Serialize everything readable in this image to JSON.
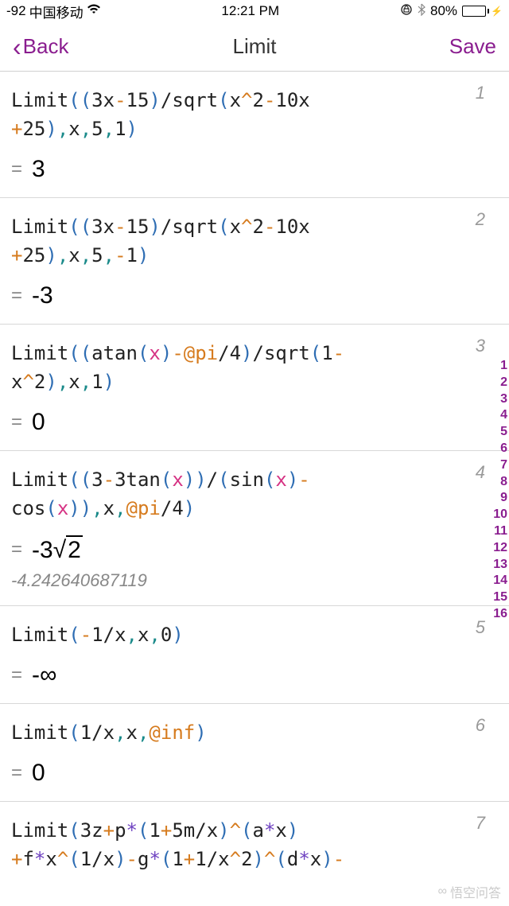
{
  "status": {
    "signal": "-92",
    "carrier": "中国移动",
    "time": "12:21 PM",
    "battery_pct": "80%"
  },
  "nav": {
    "back": "Back",
    "title": "Limit",
    "save": "Save"
  },
  "entries": [
    {
      "num": "1",
      "tokens": [
        {
          "t": "Limit",
          "c": "t-black"
        },
        {
          "t": "(",
          "c": "t-paren"
        },
        {
          "t": "(",
          "c": "t-paren"
        },
        {
          "t": "3x",
          "c": "t-black"
        },
        {
          "t": "-",
          "c": "t-orange"
        },
        {
          "t": "15",
          "c": "t-black"
        },
        {
          "t": ")",
          "c": "t-paren"
        },
        {
          "t": "/",
          "c": "t-black"
        },
        {
          "t": "sqrt",
          "c": "t-black"
        },
        {
          "t": "(",
          "c": "t-paren"
        },
        {
          "t": "x",
          "c": "t-black"
        },
        {
          "t": "^",
          "c": "t-orange"
        },
        {
          "t": "2",
          "c": "t-black"
        },
        {
          "t": "-",
          "c": "t-orange"
        },
        {
          "t": "10x",
          "c": "t-black"
        },
        {
          "t": "\n",
          "c": ""
        },
        {
          "t": "+",
          "c": "t-orange"
        },
        {
          "t": "25",
          "c": "t-black"
        },
        {
          "t": ")",
          "c": "t-paren"
        },
        {
          "t": ",",
          "c": "t-teal"
        },
        {
          "t": "x",
          "c": "t-black"
        },
        {
          "t": ",",
          "c": "t-teal"
        },
        {
          "t": "5",
          "c": "t-black"
        },
        {
          "t": ",",
          "c": "t-teal"
        },
        {
          "t": "1",
          "c": "t-black"
        },
        {
          "t": ")",
          "c": "t-paren"
        }
      ],
      "result": "3"
    },
    {
      "num": "2",
      "tokens": [
        {
          "t": "Limit",
          "c": "t-black"
        },
        {
          "t": "(",
          "c": "t-paren"
        },
        {
          "t": "(",
          "c": "t-paren"
        },
        {
          "t": "3x",
          "c": "t-black"
        },
        {
          "t": "-",
          "c": "t-orange"
        },
        {
          "t": "15",
          "c": "t-black"
        },
        {
          "t": ")",
          "c": "t-paren"
        },
        {
          "t": "/",
          "c": "t-black"
        },
        {
          "t": "sqrt",
          "c": "t-black"
        },
        {
          "t": "(",
          "c": "t-paren"
        },
        {
          "t": "x",
          "c": "t-black"
        },
        {
          "t": "^",
          "c": "t-orange"
        },
        {
          "t": "2",
          "c": "t-black"
        },
        {
          "t": "-",
          "c": "t-orange"
        },
        {
          "t": "10x",
          "c": "t-black"
        },
        {
          "t": "\n",
          "c": ""
        },
        {
          "t": "+",
          "c": "t-orange"
        },
        {
          "t": "25",
          "c": "t-black"
        },
        {
          "t": ")",
          "c": "t-paren"
        },
        {
          "t": ",",
          "c": "t-teal"
        },
        {
          "t": "x",
          "c": "t-black"
        },
        {
          "t": ",",
          "c": "t-teal"
        },
        {
          "t": "5",
          "c": "t-black"
        },
        {
          "t": ",",
          "c": "t-teal"
        },
        {
          "t": "-",
          "c": "t-orange"
        },
        {
          "t": "1",
          "c": "t-black"
        },
        {
          "t": ")",
          "c": "t-paren"
        }
      ],
      "result": "-3"
    },
    {
      "num": "3",
      "tokens": [
        {
          "t": "Limit",
          "c": "t-black"
        },
        {
          "t": "(",
          "c": "t-paren"
        },
        {
          "t": "(",
          "c": "t-paren"
        },
        {
          "t": "atan",
          "c": "t-black"
        },
        {
          "t": "(",
          "c": "t-paren"
        },
        {
          "t": "x",
          "c": "t-pink"
        },
        {
          "t": ")",
          "c": "t-paren"
        },
        {
          "t": "-",
          "c": "t-orange"
        },
        {
          "t": "@pi",
          "c": "t-orange"
        },
        {
          "t": "/",
          "c": "t-black"
        },
        {
          "t": "4",
          "c": "t-black"
        },
        {
          "t": ")",
          "c": "t-paren"
        },
        {
          "t": "/",
          "c": "t-black"
        },
        {
          "t": "sqrt",
          "c": "t-black"
        },
        {
          "t": "(",
          "c": "t-paren"
        },
        {
          "t": "1",
          "c": "t-black"
        },
        {
          "t": "-",
          "c": "t-orange"
        },
        {
          "t": "\n",
          "c": ""
        },
        {
          "t": "x",
          "c": "t-black"
        },
        {
          "t": "^",
          "c": "t-orange"
        },
        {
          "t": "2",
          "c": "t-black"
        },
        {
          "t": ")",
          "c": "t-paren"
        },
        {
          "t": ",",
          "c": "t-teal"
        },
        {
          "t": "x",
          "c": "t-black"
        },
        {
          "t": ",",
          "c": "t-teal"
        },
        {
          "t": "1",
          "c": "t-black"
        },
        {
          "t": ")",
          "c": "t-paren"
        }
      ],
      "result": "0"
    },
    {
      "num": "4",
      "tokens": [
        {
          "t": "Limit",
          "c": "t-black"
        },
        {
          "t": "(",
          "c": "t-paren"
        },
        {
          "t": "(",
          "c": "t-paren"
        },
        {
          "t": "3",
          "c": "t-black"
        },
        {
          "t": "-",
          "c": "t-orange"
        },
        {
          "t": "3tan",
          "c": "t-black"
        },
        {
          "t": "(",
          "c": "t-paren"
        },
        {
          "t": "x",
          "c": "t-pink"
        },
        {
          "t": ")",
          "c": "t-paren"
        },
        {
          "t": ")",
          "c": "t-paren"
        },
        {
          "t": "/",
          "c": "t-black"
        },
        {
          "t": "(",
          "c": "t-paren"
        },
        {
          "t": "sin",
          "c": "t-black"
        },
        {
          "t": "(",
          "c": "t-paren"
        },
        {
          "t": "x",
          "c": "t-pink"
        },
        {
          "t": ")",
          "c": "t-paren"
        },
        {
          "t": "-",
          "c": "t-orange"
        },
        {
          "t": "\n",
          "c": ""
        },
        {
          "t": "cos",
          "c": "t-black"
        },
        {
          "t": "(",
          "c": "t-paren"
        },
        {
          "t": "x",
          "c": "t-pink"
        },
        {
          "t": ")",
          "c": "t-paren"
        },
        {
          "t": ")",
          "c": "t-paren"
        },
        {
          "t": ",",
          "c": "t-teal"
        },
        {
          "t": "x",
          "c": "t-black"
        },
        {
          "t": ",",
          "c": "t-teal"
        },
        {
          "t": "@pi",
          "c": "t-orange"
        },
        {
          "t": "/",
          "c": "t-black"
        },
        {
          "t": "4",
          "c": "t-black"
        },
        {
          "t": ")",
          "c": "t-paren"
        }
      ],
      "result_special": "sqrt",
      "result_prefix": "-3",
      "result_radicand": "2",
      "approx": "-4.242640687119"
    },
    {
      "num": "5",
      "tokens": [
        {
          "t": "Limit",
          "c": "t-black"
        },
        {
          "t": "(",
          "c": "t-paren"
        },
        {
          "t": "-",
          "c": "t-orange"
        },
        {
          "t": "1",
          "c": "t-black"
        },
        {
          "t": "/",
          "c": "t-black"
        },
        {
          "t": "x",
          "c": "t-black"
        },
        {
          "t": ",",
          "c": "t-teal"
        },
        {
          "t": "x",
          "c": "t-black"
        },
        {
          "t": ",",
          "c": "t-teal"
        },
        {
          "t": "0",
          "c": "t-black"
        },
        {
          "t": ")",
          "c": "t-paren"
        }
      ],
      "result": "-∞"
    },
    {
      "num": "6",
      "tokens": [
        {
          "t": "Limit",
          "c": "t-black"
        },
        {
          "t": "(",
          "c": "t-paren"
        },
        {
          "t": "1",
          "c": "t-black"
        },
        {
          "t": "/",
          "c": "t-black"
        },
        {
          "t": "x",
          "c": "t-black"
        },
        {
          "t": ",",
          "c": "t-teal"
        },
        {
          "t": "x",
          "c": "t-black"
        },
        {
          "t": ",",
          "c": "t-teal"
        },
        {
          "t": "@inf",
          "c": "t-orange"
        },
        {
          "t": ")",
          "c": "t-paren"
        }
      ],
      "result": "0"
    },
    {
      "num": "7",
      "tokens": [
        {
          "t": "Limit",
          "c": "t-black"
        },
        {
          "t": "(",
          "c": "t-paren"
        },
        {
          "t": "3z",
          "c": "t-black"
        },
        {
          "t": "+",
          "c": "t-orange"
        },
        {
          "t": "p",
          "c": "t-black"
        },
        {
          "t": "*",
          "c": "t-purple"
        },
        {
          "t": "(",
          "c": "t-paren"
        },
        {
          "t": "1",
          "c": "t-black"
        },
        {
          "t": "+",
          "c": "t-orange"
        },
        {
          "t": "5m",
          "c": "t-black"
        },
        {
          "t": "/",
          "c": "t-black"
        },
        {
          "t": "x",
          "c": "t-black"
        },
        {
          "t": ")",
          "c": "t-paren"
        },
        {
          "t": "^",
          "c": "t-orange"
        },
        {
          "t": "(",
          "c": "t-paren"
        },
        {
          "t": "a",
          "c": "t-black"
        },
        {
          "t": "*",
          "c": "t-purple"
        },
        {
          "t": "x",
          "c": "t-black"
        },
        {
          "t": ")",
          "c": "t-paren"
        },
        {
          "t": "\n",
          "c": ""
        },
        {
          "t": "+",
          "c": "t-orange"
        },
        {
          "t": "f",
          "c": "t-black"
        },
        {
          "t": "*",
          "c": "t-purple"
        },
        {
          "t": "x",
          "c": "t-black"
        },
        {
          "t": "^",
          "c": "t-orange"
        },
        {
          "t": "(",
          "c": "t-paren"
        },
        {
          "t": "1",
          "c": "t-black"
        },
        {
          "t": "/",
          "c": "t-black"
        },
        {
          "t": "x",
          "c": "t-black"
        },
        {
          "t": ")",
          "c": "t-paren"
        },
        {
          "t": "-",
          "c": "t-orange"
        },
        {
          "t": "g",
          "c": "t-black"
        },
        {
          "t": "*",
          "c": "t-purple"
        },
        {
          "t": "(",
          "c": "t-paren"
        },
        {
          "t": "1",
          "c": "t-black"
        },
        {
          "t": "+",
          "c": "t-orange"
        },
        {
          "t": "1",
          "c": "t-black"
        },
        {
          "t": "/",
          "c": "t-black"
        },
        {
          "t": "x",
          "c": "t-black"
        },
        {
          "t": "^",
          "c": "t-orange"
        },
        {
          "t": "2",
          "c": "t-black"
        },
        {
          "t": ")",
          "c": "t-paren"
        },
        {
          "t": "^",
          "c": "t-orange"
        },
        {
          "t": "(",
          "c": "t-paren"
        },
        {
          "t": "d",
          "c": "t-black"
        },
        {
          "t": "*",
          "c": "t-purple"
        },
        {
          "t": "x",
          "c": "t-black"
        },
        {
          "t": ")",
          "c": "t-paren"
        },
        {
          "t": "-",
          "c": "t-orange"
        }
      ]
    }
  ],
  "side_index": [
    "1",
    "2",
    "3",
    "4",
    "5",
    "6",
    "7",
    "8",
    "9",
    "10",
    "11",
    "12",
    "13",
    "14",
    "15",
    "16"
  ],
  "watermark": "悟空问答"
}
